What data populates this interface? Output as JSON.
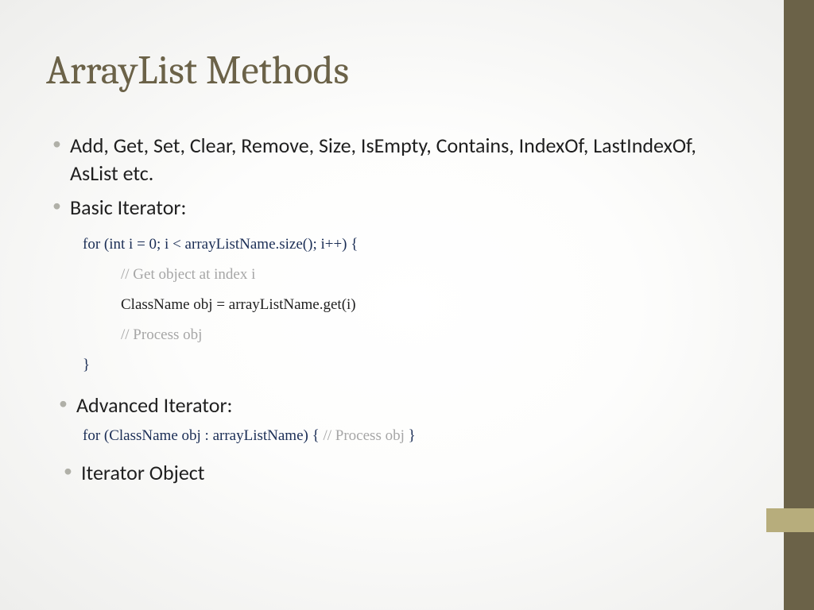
{
  "title": "ArrayList Methods",
  "bullets": {
    "b1": "Add, Get, Set, Clear, Remove, Size, IsEmpty, Contains, IndexOf, LastIndexOf, AsList etc.",
    "b2": "Basic Iterator:",
    "b3": "Advanced Iterator:",
    "b4": "Iterator Object"
  },
  "code1": {
    "l1": "for (int i = 0; i < arrayListName.size(); i++) {",
    "l2": "// Get object at index i",
    "l3": "ClassName obj = arrayListName.get(i)",
    "l4": "// Process obj",
    "l5": "}"
  },
  "code2": {
    "part1": "for (ClassName obj : arrayListName)  { ",
    "part2": " // Process obj ",
    "part3": "  }"
  }
}
